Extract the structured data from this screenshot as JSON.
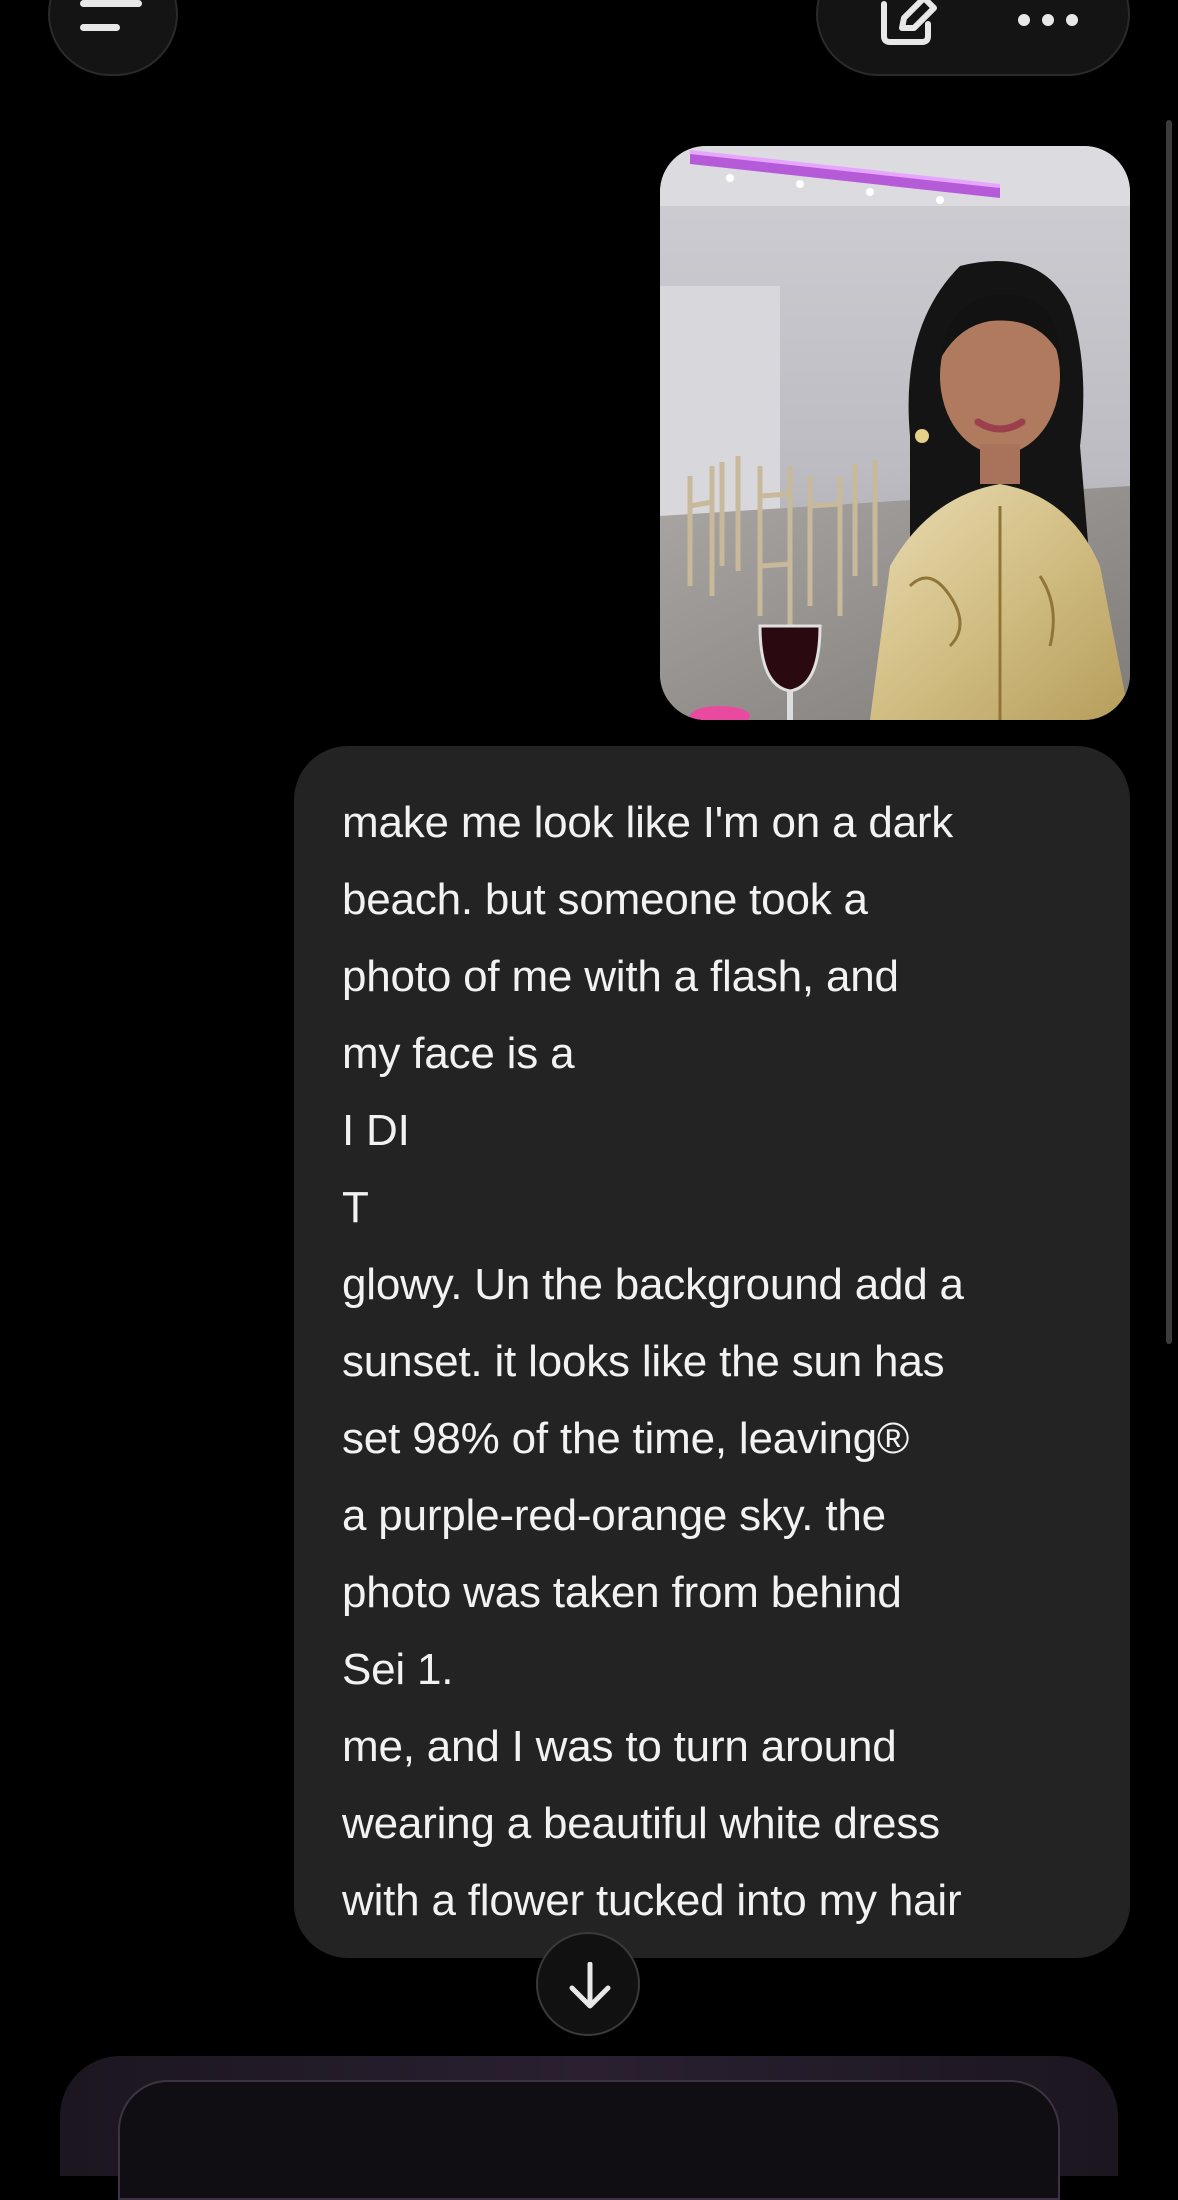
{
  "header": {
    "menu_icon": "menu-icon",
    "edit_icon": "new-chat-edit-icon",
    "more_icon": "more-dots-icon"
  },
  "conversation": {
    "user_message_lines": [
      "make me look like I'm on a dark",
      "beach. but someone took a",
      "photo of me with a flash, and",
      "my face is a",
      "I DI",
      "T",
      "glowy. Un the background add a",
      "sunset. it looks like the sun has",
      "set 98% of the time, leaving®",
      "a purple-red-orange sky. the",
      "photo was taken from behind",
      "Sei 1.",
      "me, and I was to turn around",
      "wearing a beautiful white dress",
      "with a flower tucked into my hair"
    ]
  },
  "controls": {
    "scroll_down_icon": "arrow-down-icon"
  },
  "colors": {
    "background": "#000000",
    "bubble": "#232323",
    "text": "#f2f2f2"
  }
}
